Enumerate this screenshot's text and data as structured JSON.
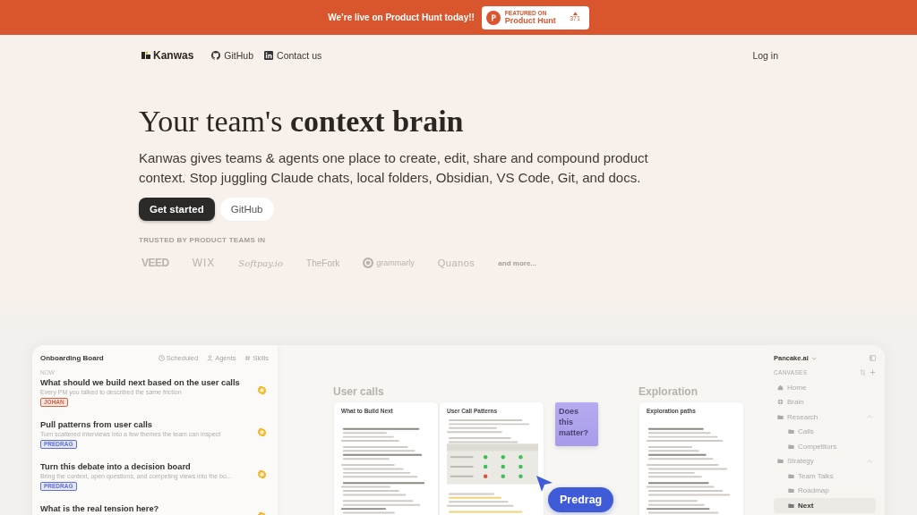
{
  "banner": {
    "text": "We’re live on Product Hunt today!!",
    "badge": {
      "eyebrow": "FEATURED ON",
      "name": "Product Hunt",
      "votes": "371"
    }
  },
  "nav": {
    "brand": "Kanwas",
    "links": [
      {
        "label": "GitHub",
        "kind": "github"
      },
      {
        "label": "Contact us",
        "kind": "linkedin"
      }
    ],
    "login": "Log in"
  },
  "hero": {
    "title": "Your team's **context brain**",
    "lead": "Kanwas gives teams & agents one place to create, edit, share and compound product context. Stop juggling Claude chats, local folders, Obsidian, VS Code, Git, and docs.",
    "buttons": [
      {
        "label": "Get started",
        "kind": "primary"
      },
      {
        "label": "GitHub",
        "kind": "secondary"
      }
    ]
  },
  "trusted": {
    "label": "TRUSTED BY PRODUCT TEAMS IN",
    "logos": [
      {
        "name": "VEED",
        "kind": "heavy"
      },
      {
        "name": "WIX",
        "kind": "wide"
      },
      {
        "name": "Softpay.io",
        "kind": "script"
      },
      {
        "name": "TheFork",
        "kind": "plain"
      },
      {
        "name": "grammarly",
        "kind": "badge"
      },
      {
        "name": "Quanos",
        "kind": "light"
      }
    ],
    "more": "and more..."
  },
  "preview": {
    "board": {
      "title": "Onboarding Board",
      "tabs": [
        {
          "label": "Scheduled",
          "kind": "clock"
        },
        {
          "label": "Agents",
          "kind": "person"
        },
        {
          "label": "Skills",
          "kind": "hash"
        }
      ],
      "section": "NOW",
      "items": [
        {
          "title": "What should we build next based on the user calls",
          "subtitle": "Every PM you talked to described the same friction",
          "tag": "JOHAN",
          "color": "#e0603f"
        },
        {
          "title": "Pull patterns from user calls",
          "subtitle": "Turn scattered interviews into a few themes the team can inspect",
          "tag": "PREDRAG",
          "color": "#5b6fe0"
        },
        {
          "title": "Turn this debate into a decision board",
          "subtitle": "Bring the context, open questions, and competing views into the bo...",
          "tag": "PREDRAG",
          "color": "#5b6fe0"
        },
        {
          "title": "What is the real tension here?"
        }
      ]
    },
    "canvas": {
      "sections": [
        {
          "title": "User calls",
          "cards": [
            {
              "title": "What to Build Next",
              "kind": "doc"
            },
            {
              "title": "User Call Patterns",
              "kind": "table"
            }
          ]
        },
        {
          "title": "Exploration",
          "cards": [
            {
              "title": "Exploration paths",
              "kind": "doc"
            }
          ]
        }
      ],
      "sticky": {
        "text": "Does this matter?"
      },
      "cursor": {
        "name": "Predrag"
      }
    },
    "sidebar": {
      "workspace": "Pancake.ai",
      "heading": "CANVASES",
      "items": [
        {
          "label": "Home",
          "kind": "home",
          "selected": false
        },
        {
          "label": "Brain",
          "kind": "grid",
          "selected": false
        },
        {
          "label": "Research",
          "kind": "folder",
          "selected": false,
          "expanded": true,
          "children": [
            {
              "label": "Calls",
              "kind": "folder",
              "selected": false
            },
            {
              "label": "Competitors",
              "kind": "folder",
              "selected": false
            }
          ]
        },
        {
          "label": "Strategy",
          "kind": "folder",
          "selected": false,
          "expanded": true,
          "children": [
            {
              "label": "Team Talks",
              "kind": "folder",
              "selected": false
            },
            {
              "label": "Roadmap",
              "kind": "folder",
              "selected": false
            },
            {
              "label": "Next",
              "kind": "folder",
              "selected": true
            }
          ]
        }
      ]
    }
  }
}
